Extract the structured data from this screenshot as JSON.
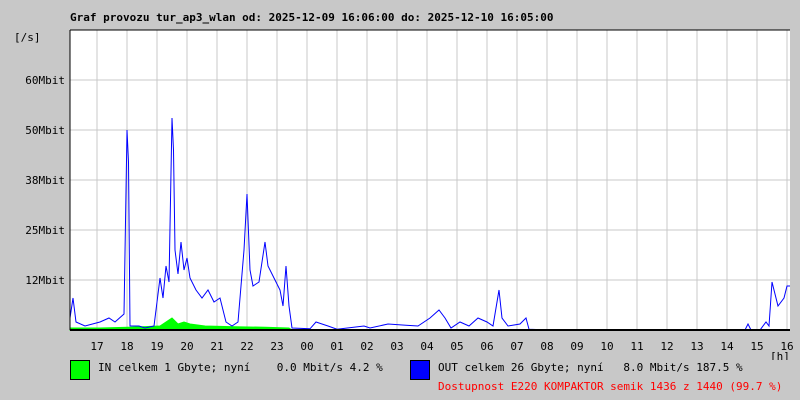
{
  "chart_data": {
    "type": "line",
    "title": "Graf provozu tur_ap3_wlan od: 2025-12-09 16:06:00 do: 2025-12-10 16:05:00",
    "ylabel": "[/s]",
    "xlabel": "[h]",
    "ylim": [
      0,
      75
    ],
    "xlim_hours_since_start": [
      0,
      24
    ],
    "grid": true,
    "yticks": [
      {
        "value": 12.5,
        "label": "12Mbit"
      },
      {
        "value": 25,
        "label": "25Mbit"
      },
      {
        "value": 37.5,
        "label": "38Mbit"
      },
      {
        "value": 50,
        "label": "50Mbit"
      },
      {
        "value": 62.5,
        "label": "60Mbit"
      }
    ],
    "xticks": [
      {
        "t": 0.9,
        "label": "17"
      },
      {
        "t": 1.9,
        "label": "18"
      },
      {
        "t": 2.9,
        "label": "19"
      },
      {
        "t": 3.9,
        "label": "20"
      },
      {
        "t": 4.9,
        "label": "21"
      },
      {
        "t": 5.9,
        "label": "22"
      },
      {
        "t": 6.9,
        "label": "23"
      },
      {
        "t": 7.9,
        "label": "00"
      },
      {
        "t": 8.9,
        "label": "01"
      },
      {
        "t": 9.9,
        "label": "02"
      },
      {
        "t": 10.9,
        "label": "03"
      },
      {
        "t": 11.9,
        "label": "04"
      },
      {
        "t": 12.9,
        "label": "05"
      },
      {
        "t": 13.9,
        "label": "06"
      },
      {
        "t": 14.9,
        "label": "07"
      },
      {
        "t": 15.9,
        "label": "08"
      },
      {
        "t": 16.9,
        "label": "09"
      },
      {
        "t": 17.9,
        "label": "10"
      },
      {
        "t": 18.9,
        "label": "11"
      },
      {
        "t": 19.9,
        "label": "12"
      },
      {
        "t": 20.9,
        "label": "13"
      },
      {
        "t": 21.9,
        "label": "14"
      },
      {
        "t": 22.9,
        "label": "15"
      },
      {
        "t": 23.9,
        "label": "16"
      }
    ],
    "series": [
      {
        "name": "IN",
        "unit": "Mbit/s",
        "color": "#00ff00",
        "points": [
          [
            0,
            0.5
          ],
          [
            1,
            0.5
          ],
          [
            2,
            0.7
          ],
          [
            3,
            1
          ],
          [
            3.4,
            3
          ],
          [
            3.6,
            1.5
          ],
          [
            3.8,
            2
          ],
          [
            4.0,
            1.5
          ],
          [
            4.5,
            1
          ],
          [
            5.5,
            0.8
          ],
          [
            6.5,
            0.7
          ],
          [
            7.3,
            0.5
          ],
          [
            7.4,
            0
          ],
          [
            24,
            0
          ]
        ]
      },
      {
        "name": "OUT",
        "unit": "Mbit/s",
        "color": "#0000ff",
        "points": [
          [
            0,
            3
          ],
          [
            0.1,
            8
          ],
          [
            0.2,
            2
          ],
          [
            0.5,
            1
          ],
          [
            1,
            2
          ],
          [
            1.3,
            3
          ],
          [
            1.5,
            2
          ],
          [
            1.8,
            4
          ],
          [
            1.9,
            50
          ],
          [
            1.95,
            42
          ],
          [
            2.0,
            1
          ],
          [
            2.3,
            1
          ],
          [
            2.5,
            0.5
          ],
          [
            2.8,
            1
          ],
          [
            3.0,
            13
          ],
          [
            3.1,
            8
          ],
          [
            3.2,
            16
          ],
          [
            3.3,
            12
          ],
          [
            3.4,
            53
          ],
          [
            3.45,
            45
          ],
          [
            3.5,
            20
          ],
          [
            3.6,
            14
          ],
          [
            3.7,
            22
          ],
          [
            3.8,
            15
          ],
          [
            3.9,
            18
          ],
          [
            4.0,
            13
          ],
          [
            4.2,
            10
          ],
          [
            4.4,
            8
          ],
          [
            4.6,
            10
          ],
          [
            4.8,
            7
          ],
          [
            5.0,
            8
          ],
          [
            5.2,
            2
          ],
          [
            5.4,
            1
          ],
          [
            5.6,
            2
          ],
          [
            5.8,
            20
          ],
          [
            5.9,
            34
          ],
          [
            6.0,
            15
          ],
          [
            6.1,
            11
          ],
          [
            6.3,
            12
          ],
          [
            6.5,
            22
          ],
          [
            6.6,
            16
          ],
          [
            6.8,
            13
          ],
          [
            7.0,
            10
          ],
          [
            7.1,
            6
          ],
          [
            7.2,
            16
          ],
          [
            7.3,
            6
          ],
          [
            7.4,
            0.5
          ],
          [
            8.0,
            0.3
          ],
          [
            8.2,
            2
          ],
          [
            8.4,
            1.5
          ],
          [
            8.6,
            1
          ],
          [
            8.9,
            0.2
          ],
          [
            9.8,
            1
          ],
          [
            10.0,
            0.5
          ],
          [
            10.6,
            1.5
          ],
          [
            11.2,
            1.2
          ],
          [
            11.6,
            1
          ],
          [
            12.0,
            3
          ],
          [
            12.3,
            5
          ],
          [
            12.5,
            3
          ],
          [
            12.7,
            0.5
          ],
          [
            13.0,
            2
          ],
          [
            13.3,
            1
          ],
          [
            13.6,
            3
          ],
          [
            13.9,
            2
          ],
          [
            14.1,
            1
          ],
          [
            14.3,
            10
          ],
          [
            14.4,
            3
          ],
          [
            14.6,
            1
          ],
          [
            15.0,
            1.5
          ],
          [
            15.2,
            3
          ],
          [
            15.3,
            0.2
          ],
          [
            16,
            0
          ],
          [
            22.5,
            0
          ],
          [
            22.6,
            1.5
          ],
          [
            22.7,
            0
          ],
          [
            23.0,
            0
          ],
          [
            23.2,
            2
          ],
          [
            23.3,
            1
          ],
          [
            23.4,
            12
          ],
          [
            23.6,
            6
          ],
          [
            23.8,
            8
          ],
          [
            23.9,
            11
          ],
          [
            24,
            11
          ]
        ]
      }
    ]
  },
  "legend": {
    "in_text": "IN celkem 1 Gbyte; nyní    0.0 Mbit/s 4.2 %",
    "out_text": "OUT celkem 26 Gbyte; nyní   8.0 Mbit/s 187.5 %",
    "availability": "Dostupnost E220 KOMPAKTOR semik 1436 z 1440 (99.7 %)",
    "in_color": "#00ff00",
    "out_color": "#0000ff",
    "availability_color": "#ff0000"
  }
}
